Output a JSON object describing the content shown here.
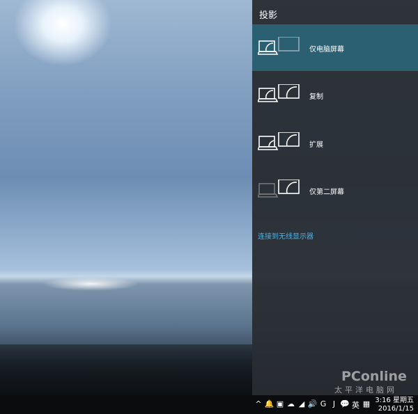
{
  "panel": {
    "title": "投影",
    "options": [
      {
        "label": "仅电脑屏幕",
        "icon": "pc-screen-only-icon",
        "selected": true
      },
      {
        "label": "复制",
        "icon": "duplicate-icon",
        "selected": false
      },
      {
        "label": "扩展",
        "icon": "extend-icon",
        "selected": false
      },
      {
        "label": "仅第二屏幕",
        "icon": "second-screen-only-icon",
        "selected": false
      }
    ],
    "link": "连接到无线显示器"
  },
  "colors": {
    "selected": "#2b5f72",
    "link": "#4fb2e0",
    "panel": "#2c3035"
  },
  "watermark": {
    "brand": "PConline",
    "sub": "太平洋电脑网"
  },
  "taskbar": {
    "tray": [
      "^",
      "🔔",
      "▣",
      "☁",
      "◢",
      "🔊",
      "G",
      "J",
      "💬",
      "英",
      "▦"
    ],
    "time": "3:16 星期五",
    "date": "2016/1/15"
  }
}
